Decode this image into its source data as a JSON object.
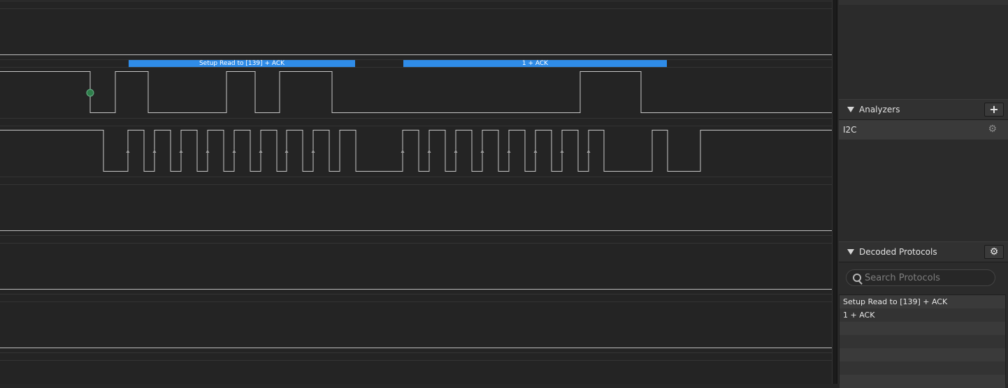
{
  "analyzers_panel": {
    "title": "Analyzers",
    "add_label": "+",
    "gear": "⚙"
  },
  "analyzers": [
    {
      "name": "I2C"
    }
  ],
  "decoded_panel": {
    "title": "Decoded Protocols",
    "gear": "⚙"
  },
  "search": {
    "placeholder": "Search Protocols"
  },
  "decoded_items": [
    "Setup Read to [139] + ACK",
    "1 + ACK"
  ],
  "frames": [
    {
      "label": "Setup Read to [139] + ACK"
    },
    {
      "label": "1 + ACK"
    }
  ]
}
